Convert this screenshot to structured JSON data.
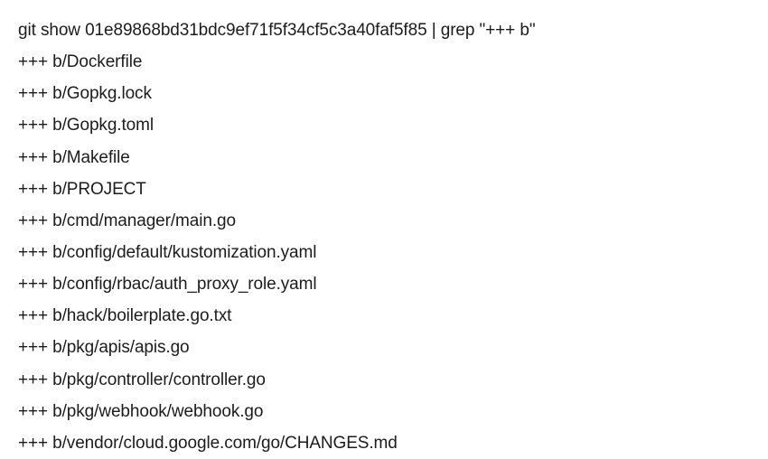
{
  "command": "git show 01e89868bd31bdc9ef71f5f34cf5c3a40faf5f85 | grep \"+++ b\"",
  "output_lines": [
    "+++ b/Dockerfile",
    "+++ b/Gopkg.lock",
    "+++ b/Gopkg.toml",
    "+++ b/Makefile",
    "+++ b/PROJECT",
    "+++ b/cmd/manager/main.go",
    "+++ b/config/default/kustomization.yaml",
    "+++ b/config/rbac/auth_proxy_role.yaml",
    "+++ b/hack/boilerplate.go.txt",
    "+++ b/pkg/apis/apis.go",
    "+++ b/pkg/controller/controller.go",
    "+++ b/pkg/webhook/webhook.go",
    "+++ b/vendor/cloud.google.com/go/CHANGES.md"
  ]
}
